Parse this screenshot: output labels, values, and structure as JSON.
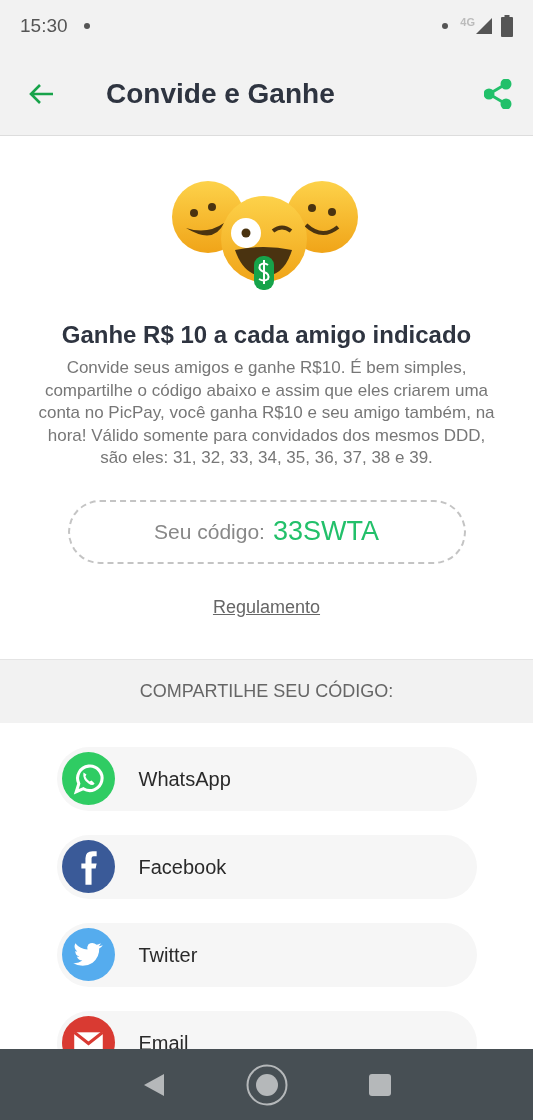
{
  "status_bar": {
    "time": "15:30",
    "network": "4G"
  },
  "app_bar": {
    "title": "Convide e Ganhe"
  },
  "invite": {
    "title": "Ganhe R$ 10 a cada amigo indicado",
    "description": "Convide seus amigos e ganhe R$10. É bem simples, compartilhe o código abaixo e assim que eles criarem uma conta no PicPay, você ganha R$10 e seu amigo também, na hora! Válido somente para convidados dos mesmos DDD, são eles: 31, 32, 33, 34, 35, 36, 37, 38 e 39.",
    "code_label": "Seu código:",
    "code": "33SWTA",
    "rules_link": "Regulamento"
  },
  "share": {
    "heading": "COMPARTILHE SEU CÓDIGO:",
    "items": [
      {
        "kind": "whatsapp",
        "label": "WhatsApp"
      },
      {
        "kind": "facebook",
        "label": "Facebook"
      },
      {
        "kind": "twitter",
        "label": "Twitter"
      },
      {
        "kind": "email",
        "label": "Email"
      }
    ]
  }
}
